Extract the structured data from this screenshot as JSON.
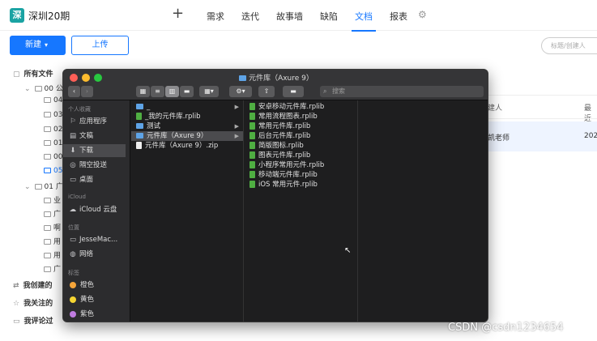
{
  "app": {
    "logo_char": "深",
    "project_name": "深圳20期",
    "plus_glyph": "+",
    "nav": [
      "需求",
      "迭代",
      "故事墙",
      "缺陷",
      "文档",
      "报表"
    ],
    "active_nav_index": 4,
    "gear_glyph": "⚙"
  },
  "toolbar": {
    "new_label": "新建",
    "new_caret": "▾",
    "upload_label": "上传",
    "search_placeholder": "标题/创建人"
  },
  "sidebar": {
    "all_files": "所有文件",
    "group1": "00 公",
    "sub1": [
      "04",
      "03",
      "02",
      "01",
      "00",
      "05"
    ],
    "group2": "01 广",
    "sub2": [
      "业",
      "广",
      "啊",
      "用",
      "用",
      "广"
    ],
    "my_created": "我创建的",
    "my_followed": "我关注的",
    "my_commented": "我评论过"
  },
  "table": {
    "owner_header": "建人",
    "date_header": "最近",
    "owner_value": "凯老师",
    "date_value": "202"
  },
  "finder": {
    "title": "元件库（Axure 9）",
    "search_placeholder": "搜索",
    "sidebar": {
      "favorites_header": "个人收藏",
      "favorites": [
        {
          "icon": "applications-icon",
          "glyph": "⚐",
          "label": "应用程序"
        },
        {
          "icon": "documents-icon",
          "glyph": "▤",
          "label": "文稿"
        },
        {
          "icon": "downloads-icon",
          "glyph": "⬇",
          "label": "下载"
        },
        {
          "icon": "airdrop-icon",
          "glyph": "◎",
          "label": "隔空投送"
        },
        {
          "icon": "desktop-icon",
          "glyph": "▭",
          "label": "桌面"
        }
      ],
      "icloud_header": "iCloud",
      "icloud_item": "iCloud 云盘",
      "locations_header": "位置",
      "locations": [
        {
          "icon": "computer-icon",
          "glyph": "▭",
          "label": "JesseMac..."
        },
        {
          "icon": "network-icon",
          "glyph": "◍",
          "label": "网络"
        }
      ],
      "tags_header": "标签",
      "tags": [
        {
          "label": "橙色",
          "color": "#f7a63a"
        },
        {
          "label": "黄色",
          "color": "#f5d532"
        },
        {
          "label": "紫色",
          "color": "#c07ce0"
        }
      ]
    },
    "col1": [
      {
        "type": "folder",
        "name": "_",
        "arrow": "▶"
      },
      {
        "type": "rplib",
        "name": "_我的元件库.rplib",
        "arrow": ""
      },
      {
        "type": "folder",
        "name": "测试",
        "arrow": "▶"
      },
      {
        "type": "folder",
        "name": "元件库（Axure 9）",
        "arrow": "▶"
      },
      {
        "type": "zip",
        "name": "元件库（Axure 9）.zip",
        "arrow": ""
      }
    ],
    "col1_selected_index": 3,
    "col2": [
      "安卓移动元件库.rplib",
      "常用流程图表.rplib",
      "常用元件库.rplib",
      "后台元件库.rplib",
      "简版图标.rplib",
      "图表元件库.rplib",
      "小程序常用元件.rplib",
      "移动端元件库.rplib",
      "iOS 常用元件.rplib"
    ]
  },
  "watermark": "CSDN @csdn1234654",
  "colors": {
    "primary": "#1677ff",
    "finder_bg": "#1e1e1f",
    "rplib_icon": "#4fae42",
    "folder_icon": "#5ea3e6"
  }
}
